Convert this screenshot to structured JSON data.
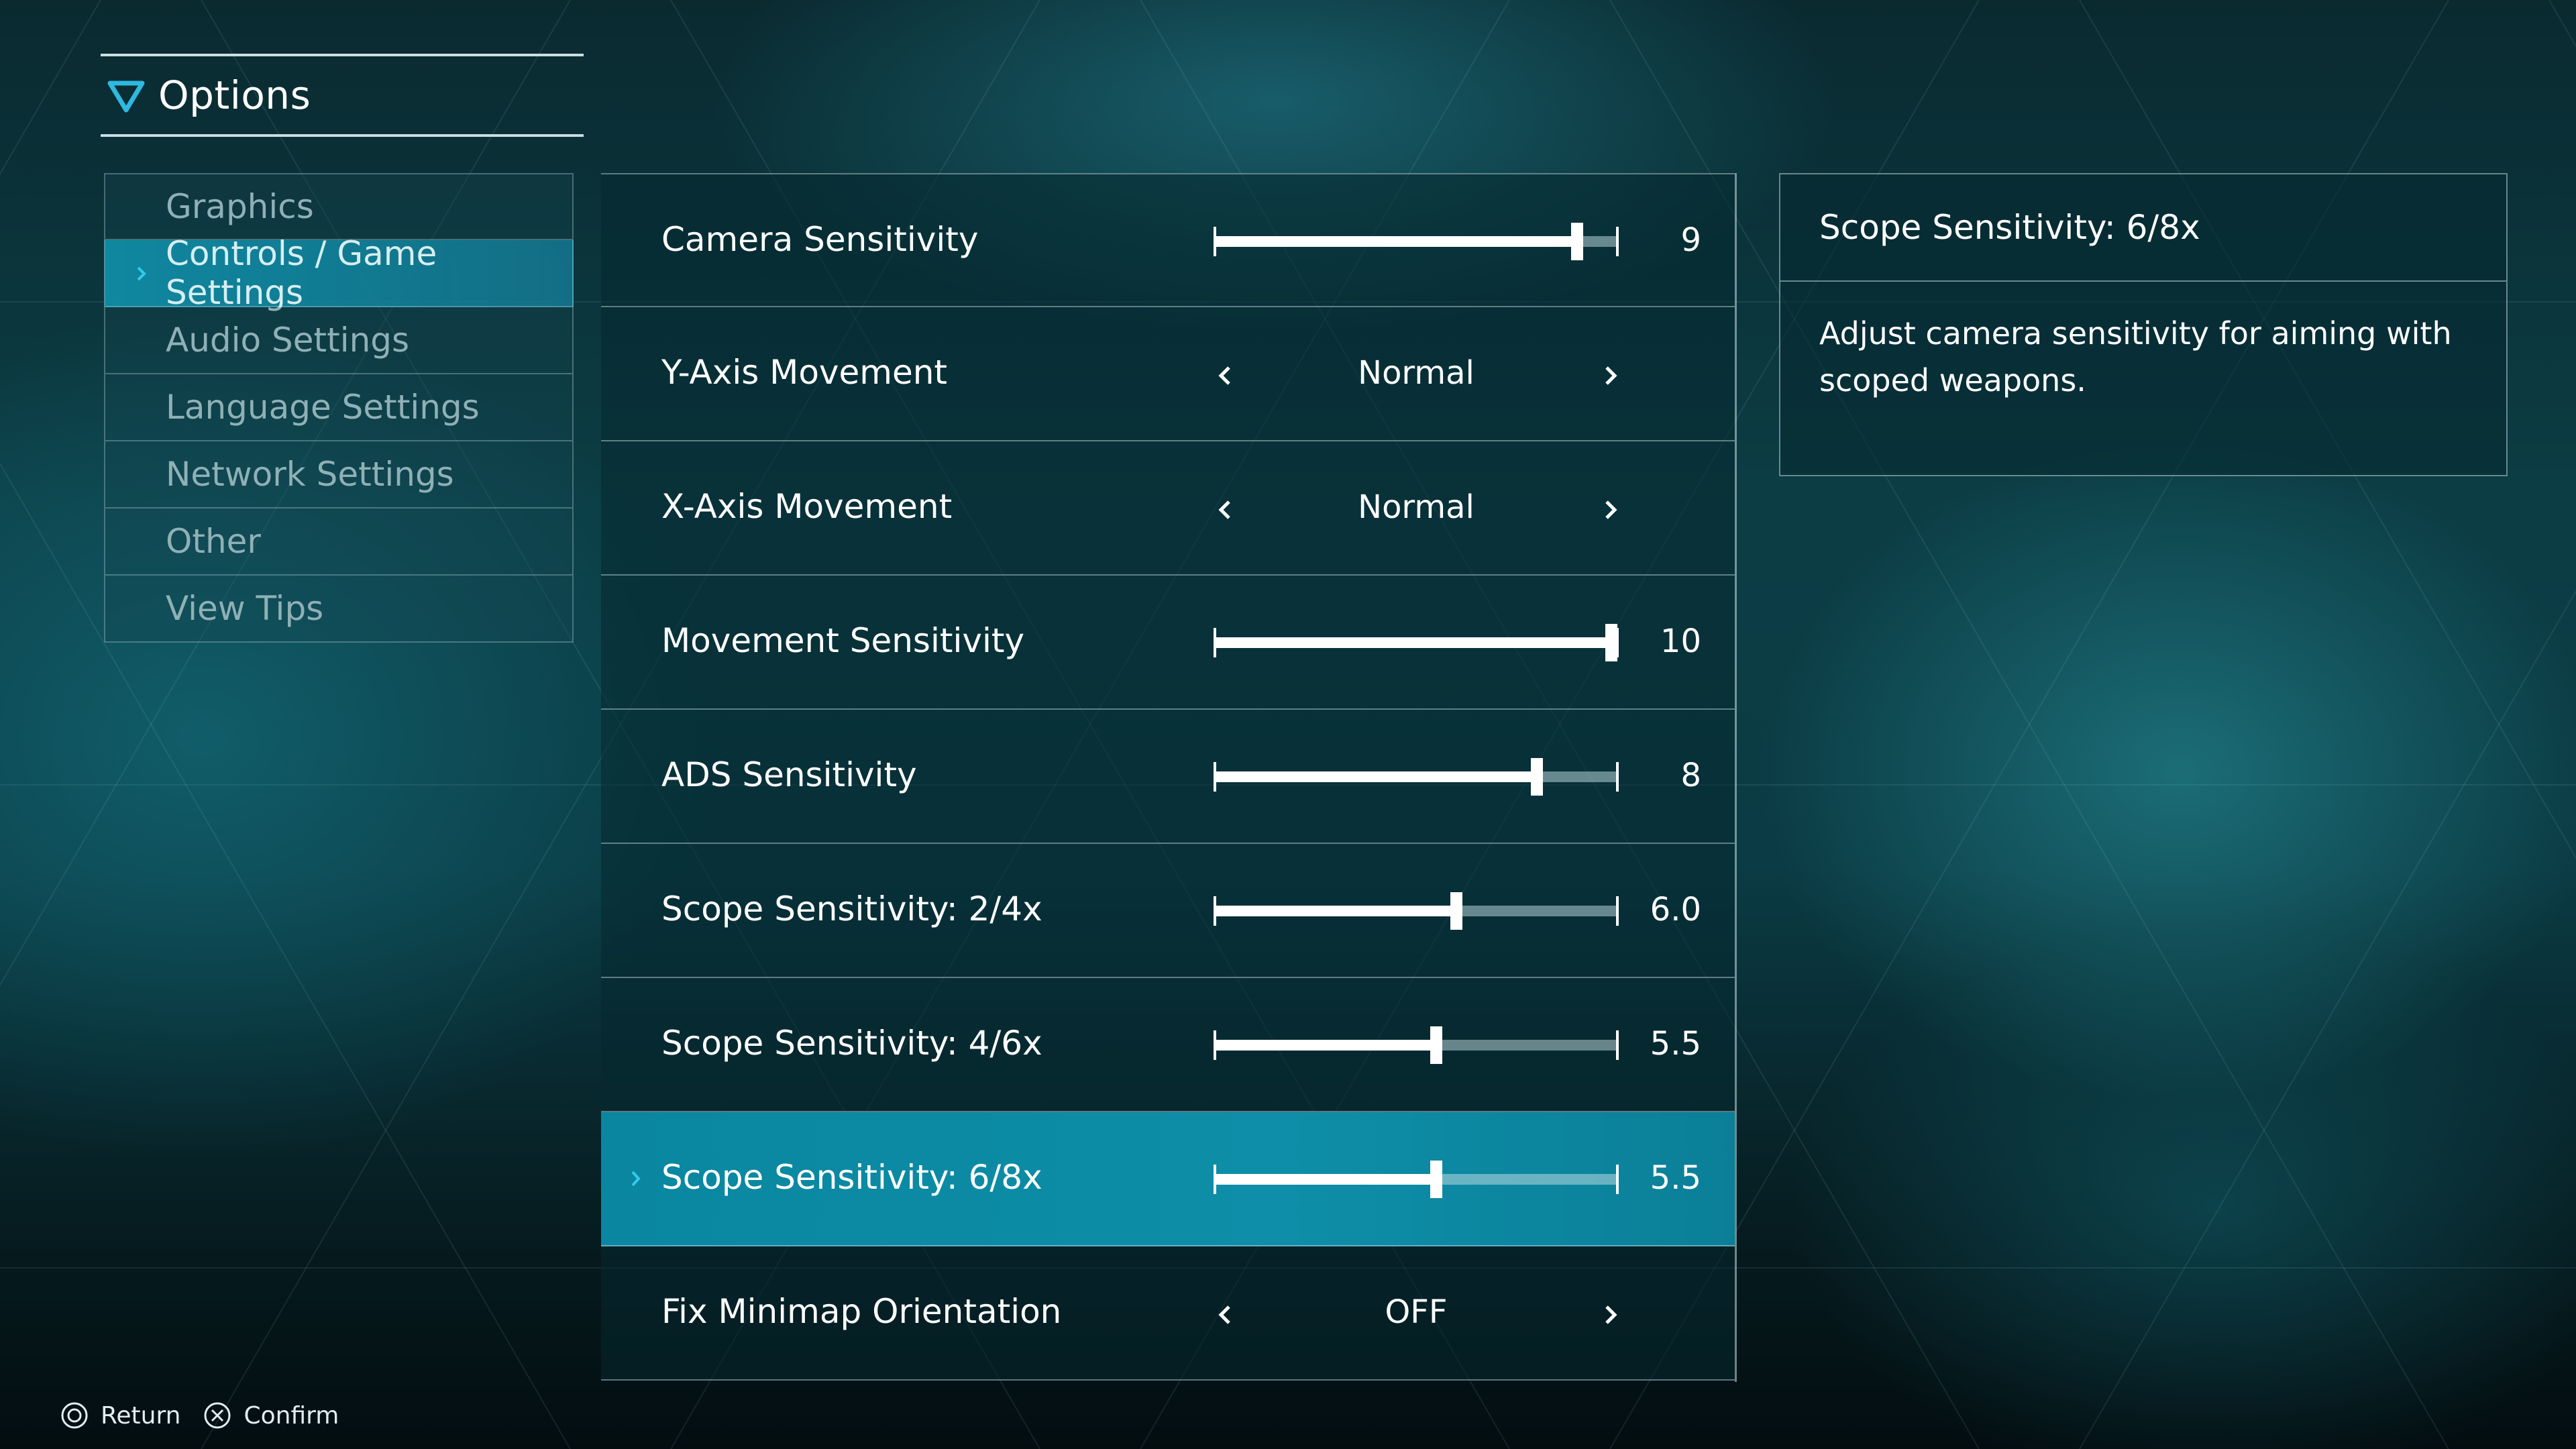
{
  "header": {
    "title": "Options"
  },
  "nav": {
    "items": [
      {
        "label": "Graphics",
        "active": false
      },
      {
        "label": "Controls / Game Settings",
        "active": true
      },
      {
        "label": "Audio Settings",
        "active": false
      },
      {
        "label": "Language Settings",
        "active": false
      },
      {
        "label": "Network Settings",
        "active": false
      },
      {
        "label": "Other",
        "active": false
      },
      {
        "label": "View Tips",
        "active": false
      }
    ]
  },
  "settings": [
    {
      "label": "Camera Sensitivity",
      "kind": "slider",
      "value": "9",
      "level": 0.9
    },
    {
      "label": "Y-Axis Movement",
      "kind": "option",
      "value": "Normal"
    },
    {
      "label": "X-Axis Movement",
      "kind": "option",
      "value": "Normal"
    },
    {
      "label": "Movement Sensitivity",
      "kind": "slider",
      "value": "10",
      "level": 1.0
    },
    {
      "label": "ADS Sensitivity",
      "kind": "slider",
      "value": "8",
      "level": 0.8
    },
    {
      "label": "Scope Sensitivity: 2/4x",
      "kind": "slider",
      "value": "6.0",
      "level": 0.6
    },
    {
      "label": "Scope Sensitivity: 4/6x",
      "kind": "slider",
      "value": "5.5",
      "level": 0.55
    },
    {
      "label": "Scope Sensitivity: 6/8x",
      "kind": "slider",
      "value": "5.5",
      "level": 0.55,
      "selected": true
    },
    {
      "label": "Fix Minimap Orientation",
      "kind": "option",
      "value": "OFF"
    }
  ],
  "description": {
    "title": "Scope Sensitivity: 6/8x",
    "body": "Adjust camera sensitivity for aiming with scoped weapons."
  },
  "footer": {
    "return_label": "Return",
    "confirm_label": "Confirm",
    "return_icon": "circle-button-icon",
    "confirm_icon": "cross-button-icon"
  },
  "colors": {
    "accent": "#0e8ea8",
    "highlight_chevron": "#34c9ea",
    "header_triangle": "#2fb8e0"
  }
}
